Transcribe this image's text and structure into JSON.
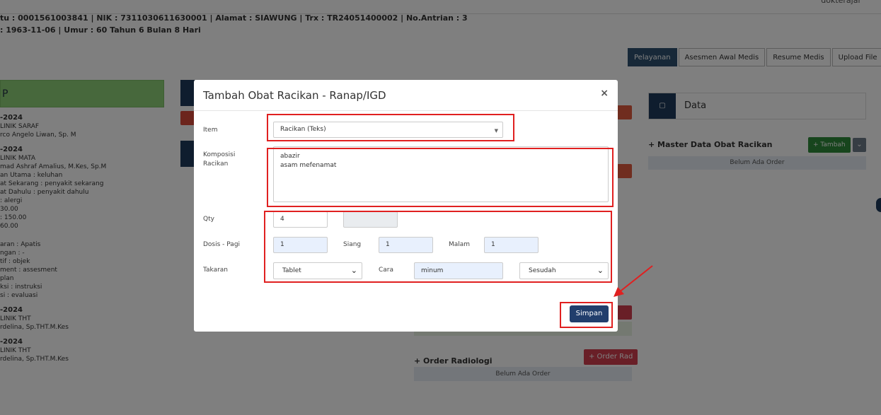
{
  "header": {
    "user": "dokterajar",
    "patient_line1": "tu : 0001561003841 | NIK : 7311030611630001 | Alamat : SIAWUNG | Trx : TR24051400002 | No.Antrian : 3",
    "patient_line2": ": 1963-11-06 | Umur : 60 Tahun 6 Bulan 8 Hari"
  },
  "tabs": [
    "Pelayanan",
    "Asesmen Awal Medis",
    "Resume Medis",
    "Upload File"
  ],
  "left_panel": {
    "head": "P",
    "entries": [
      {
        "date": "-2024",
        "lines": [
          "LINIK SARAF",
          "rco Angelo Liwan, Sp. M"
        ]
      },
      {
        "date": "-2024",
        "lines": [
          "LINIK MATA",
          "mad Ashraf Amalius, M.Kes, Sp.M",
          "an Utama : keluhan",
          "at Sekarang : penyakit sekarang",
          "at Dahulu : penyakit dahulu",
          ": alergi",
          "30.00",
          ": 150.00",
          "60.00",
          "",
          "aran : Apatis",
          "ngan : -",
          "tif : objek",
          "ment : assesment",
          "plan",
          "ksi : instruksi",
          "si : evaluasi"
        ]
      },
      {
        "date": "-2024",
        "lines": [
          "LINIK THT",
          "rdelina, Sp.THT.M.Kes"
        ]
      },
      {
        "date": "-2024",
        "lines": [
          "LINIK THT",
          "rdelina, Sp.THT.M.Kes"
        ]
      }
    ]
  },
  "right_panel": {
    "data_label": "Data",
    "master_title": "+ Master Data Obat Racikan",
    "tambah_label": "+ Tambah",
    "empty_text": "Belum Ada Order"
  },
  "radiologi": {
    "title": "+ Order Radiologi",
    "button": "+ Order Rad",
    "empty_text": "Belum Ada Order"
  },
  "modal": {
    "title": "Tambah Obat Racikan - Ranap/IGD",
    "item_label": "Item",
    "item_value": "Racikan (Teks)",
    "komposisi_label_1": "Komposisi",
    "komposisi_label_2": "Racikan",
    "komposisi_value": "abazir\nasam mefenamat",
    "qty_label": "Qty",
    "qty_value": "4",
    "dosis_pagi_label": "Dosis - Pagi",
    "dosis_pagi_value": "1",
    "siang_label": "Siang",
    "siang_value": "1",
    "malam_label": "Malam",
    "malam_value": "1",
    "takaran_label": "Takaran",
    "takaran_value": "Tablet",
    "cara_label": "Cara",
    "cara_value": "minum",
    "waktu_value": "Sesudah",
    "submit_label": "Simpan"
  },
  "colors": {
    "highlight": "#e02020",
    "primary_button": "#213e6c"
  }
}
